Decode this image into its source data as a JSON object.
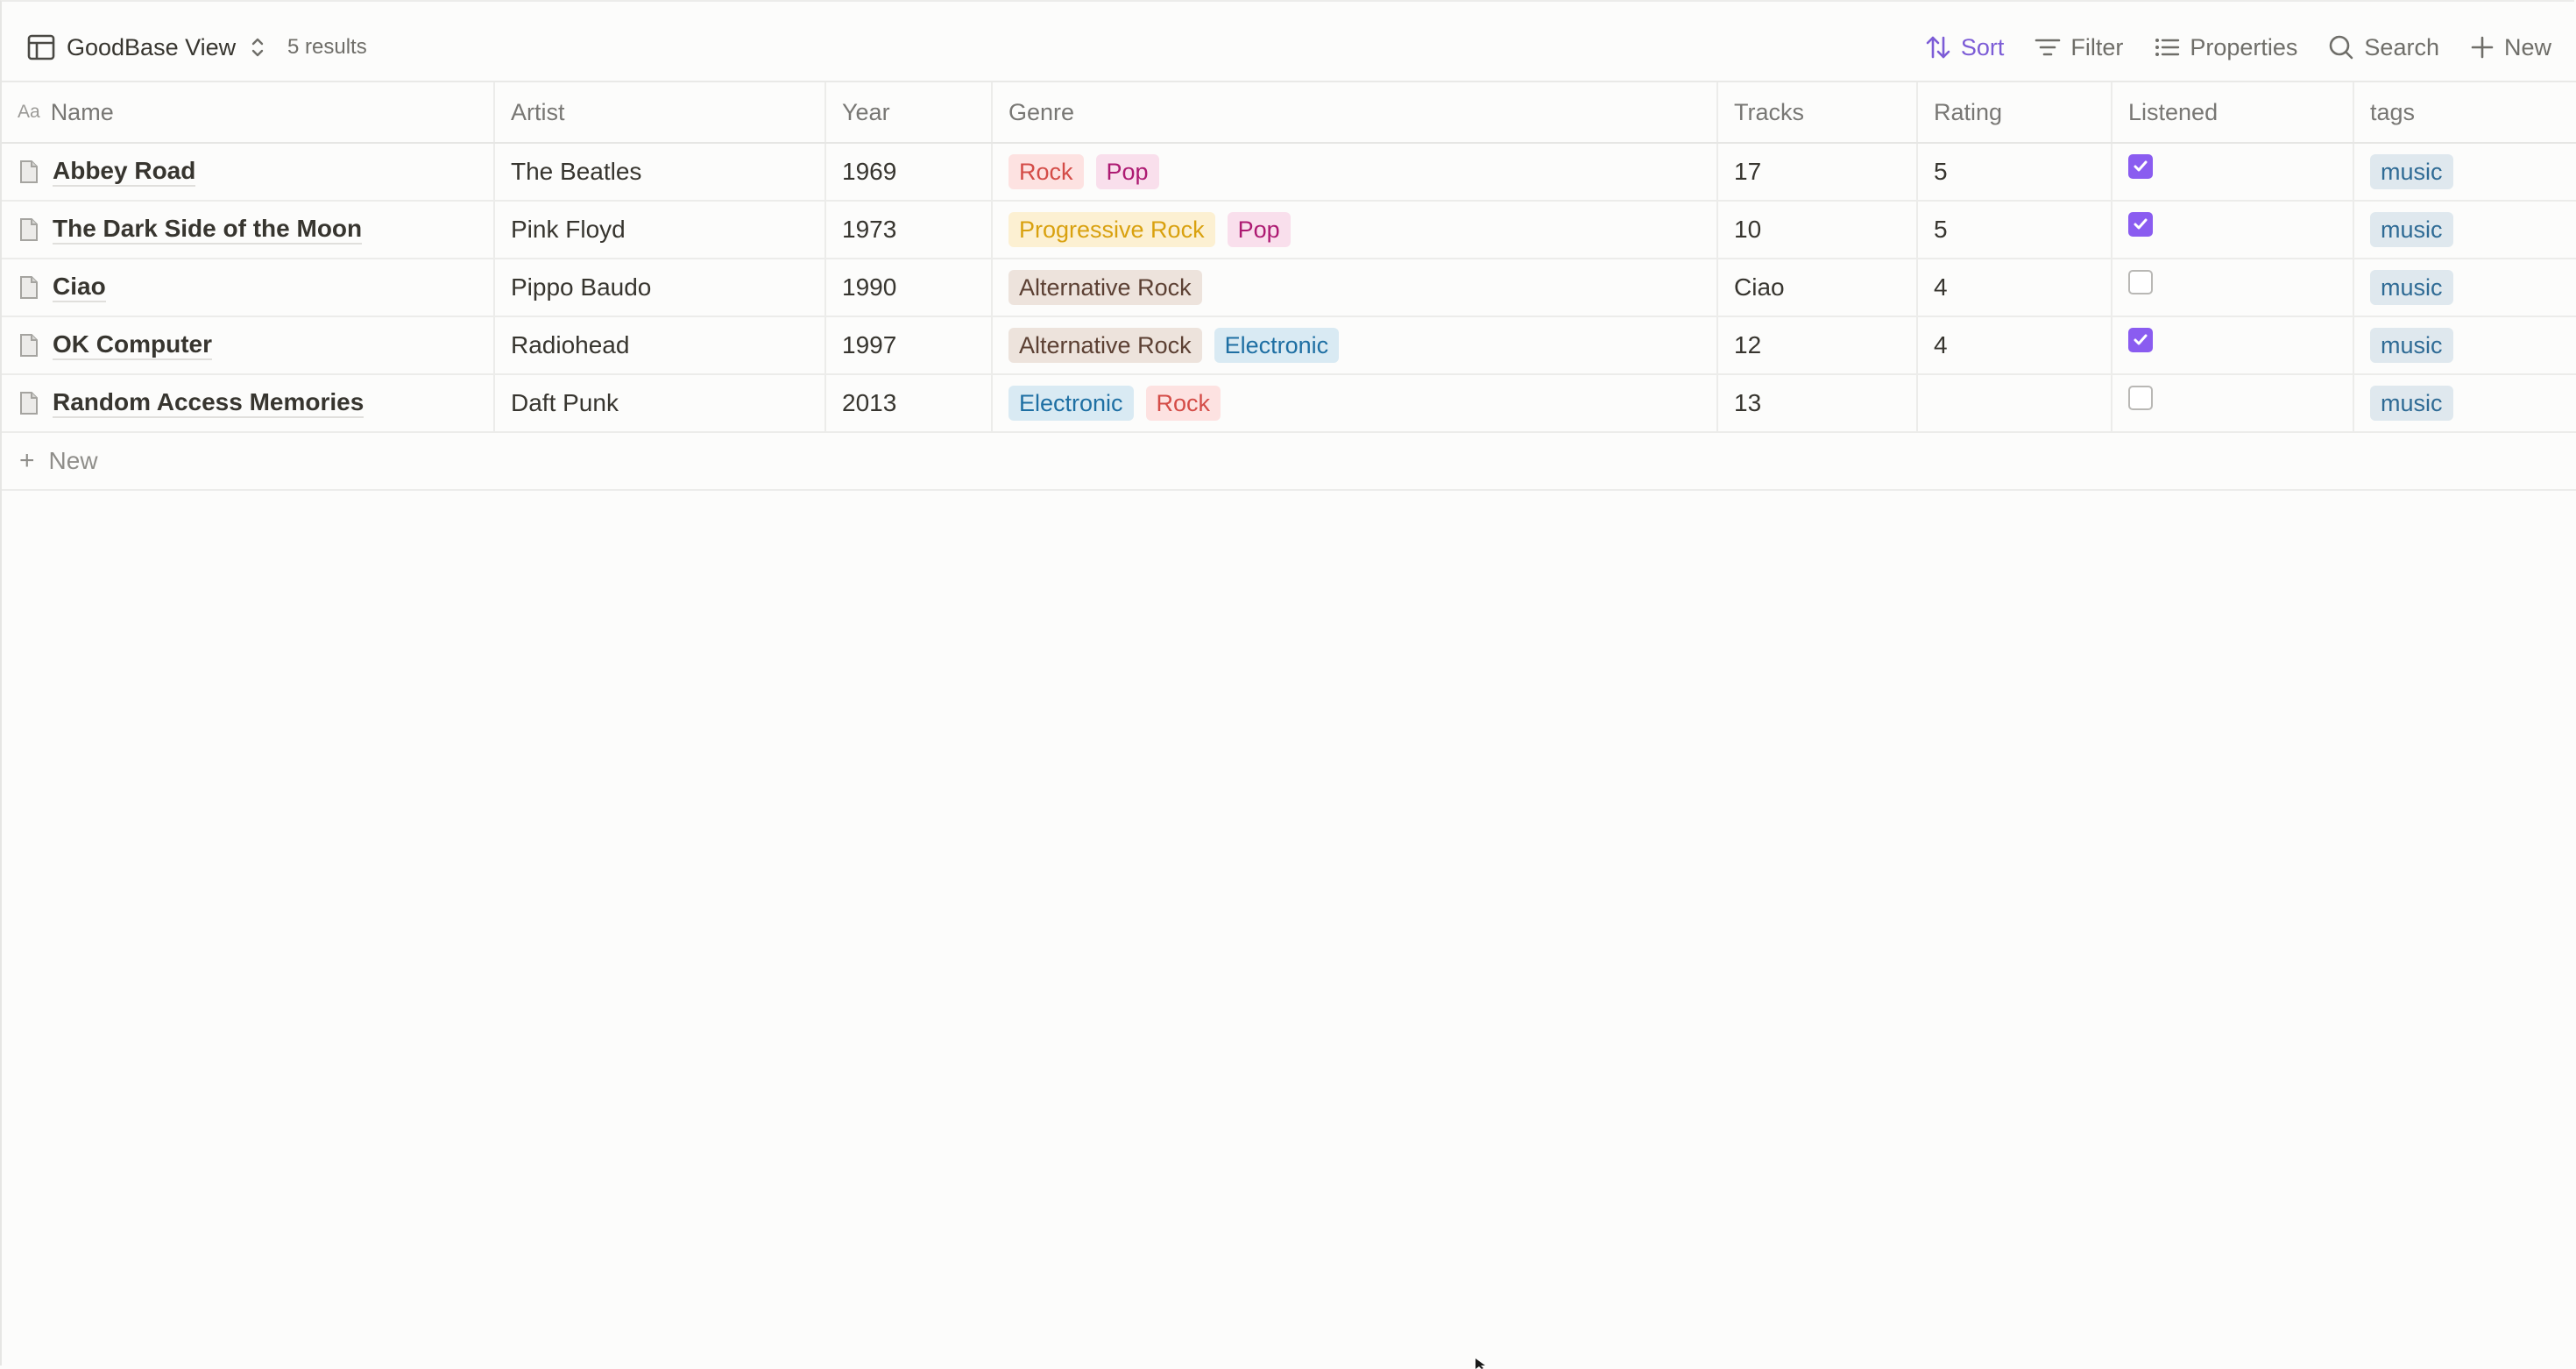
{
  "toolbar": {
    "view_name": "GoodBase View",
    "results": "5 results",
    "sort_label": "Sort",
    "filter_label": "Filter",
    "properties_label": "Properties",
    "search_label": "Search",
    "new_label": "New",
    "accent_color": "#7c5cd6"
  },
  "table": {
    "columns": [
      "Name",
      "Artist",
      "Year",
      "Genre",
      "Tracks",
      "Rating",
      "Listened",
      "tags"
    ],
    "name_icon": "Aa",
    "rows": [
      {
        "name": "Abbey Road",
        "artist": "The Beatles",
        "year": "1969",
        "genres": [
          {
            "label": "Rock",
            "color": "red"
          },
          {
            "label": "Pop",
            "color": "pink"
          }
        ],
        "tracks": "17",
        "rating": "5",
        "listened": true,
        "tags": [
          "music"
        ]
      },
      {
        "name": "The Dark Side of the Moon",
        "artist": "Pink Floyd",
        "year": "1973",
        "genres": [
          {
            "label": "Progressive Rock",
            "color": "yellow"
          },
          {
            "label": "Pop",
            "color": "pink"
          }
        ],
        "tracks": "10",
        "rating": "5",
        "listened": true,
        "tags": [
          "music"
        ]
      },
      {
        "name": "Ciao",
        "artist": "Pippo Baudo",
        "year": "1990",
        "genres": [
          {
            "label": "Alternative Rock",
            "color": "brown"
          }
        ],
        "tracks": "Ciao",
        "rating": "4",
        "listened": false,
        "tags": [
          "music"
        ]
      },
      {
        "name": "OK Computer",
        "artist": "Radiohead",
        "year": "1997",
        "genres": [
          {
            "label": "Alternative Rock",
            "color": "brown"
          },
          {
            "label": "Electronic",
            "color": "blue"
          }
        ],
        "tracks": "12",
        "rating": "4",
        "listened": true,
        "tags": [
          "music"
        ]
      },
      {
        "name": "Random Access Memories",
        "artist": "Daft Punk",
        "year": "2013",
        "genres": [
          {
            "label": "Electronic",
            "color": "blue"
          },
          {
            "label": "Rock",
            "color": "red"
          }
        ],
        "tracks": "13",
        "rating": "",
        "listened": false,
        "tags": [
          "music"
        ]
      }
    ],
    "new_row_label": "New"
  },
  "tag_colors": {
    "red": {
      "bg": "#fde2e1",
      "fg": "#d44c47"
    },
    "pink": {
      "bg": "#f9dfec",
      "fg": "#ad1a72"
    },
    "yellow": {
      "bg": "#fcf0d2",
      "fg": "#d9a10f"
    },
    "brown": {
      "bg": "#ede3dc",
      "fg": "#5c4033"
    },
    "blue": {
      "bg": "#d9eaf3",
      "fg": "#1e6fa3"
    },
    "gray": {
      "bg": "#dfe8ee",
      "fg": "#2f6b95"
    }
  },
  "checkbox_color": "#8a5cf0"
}
